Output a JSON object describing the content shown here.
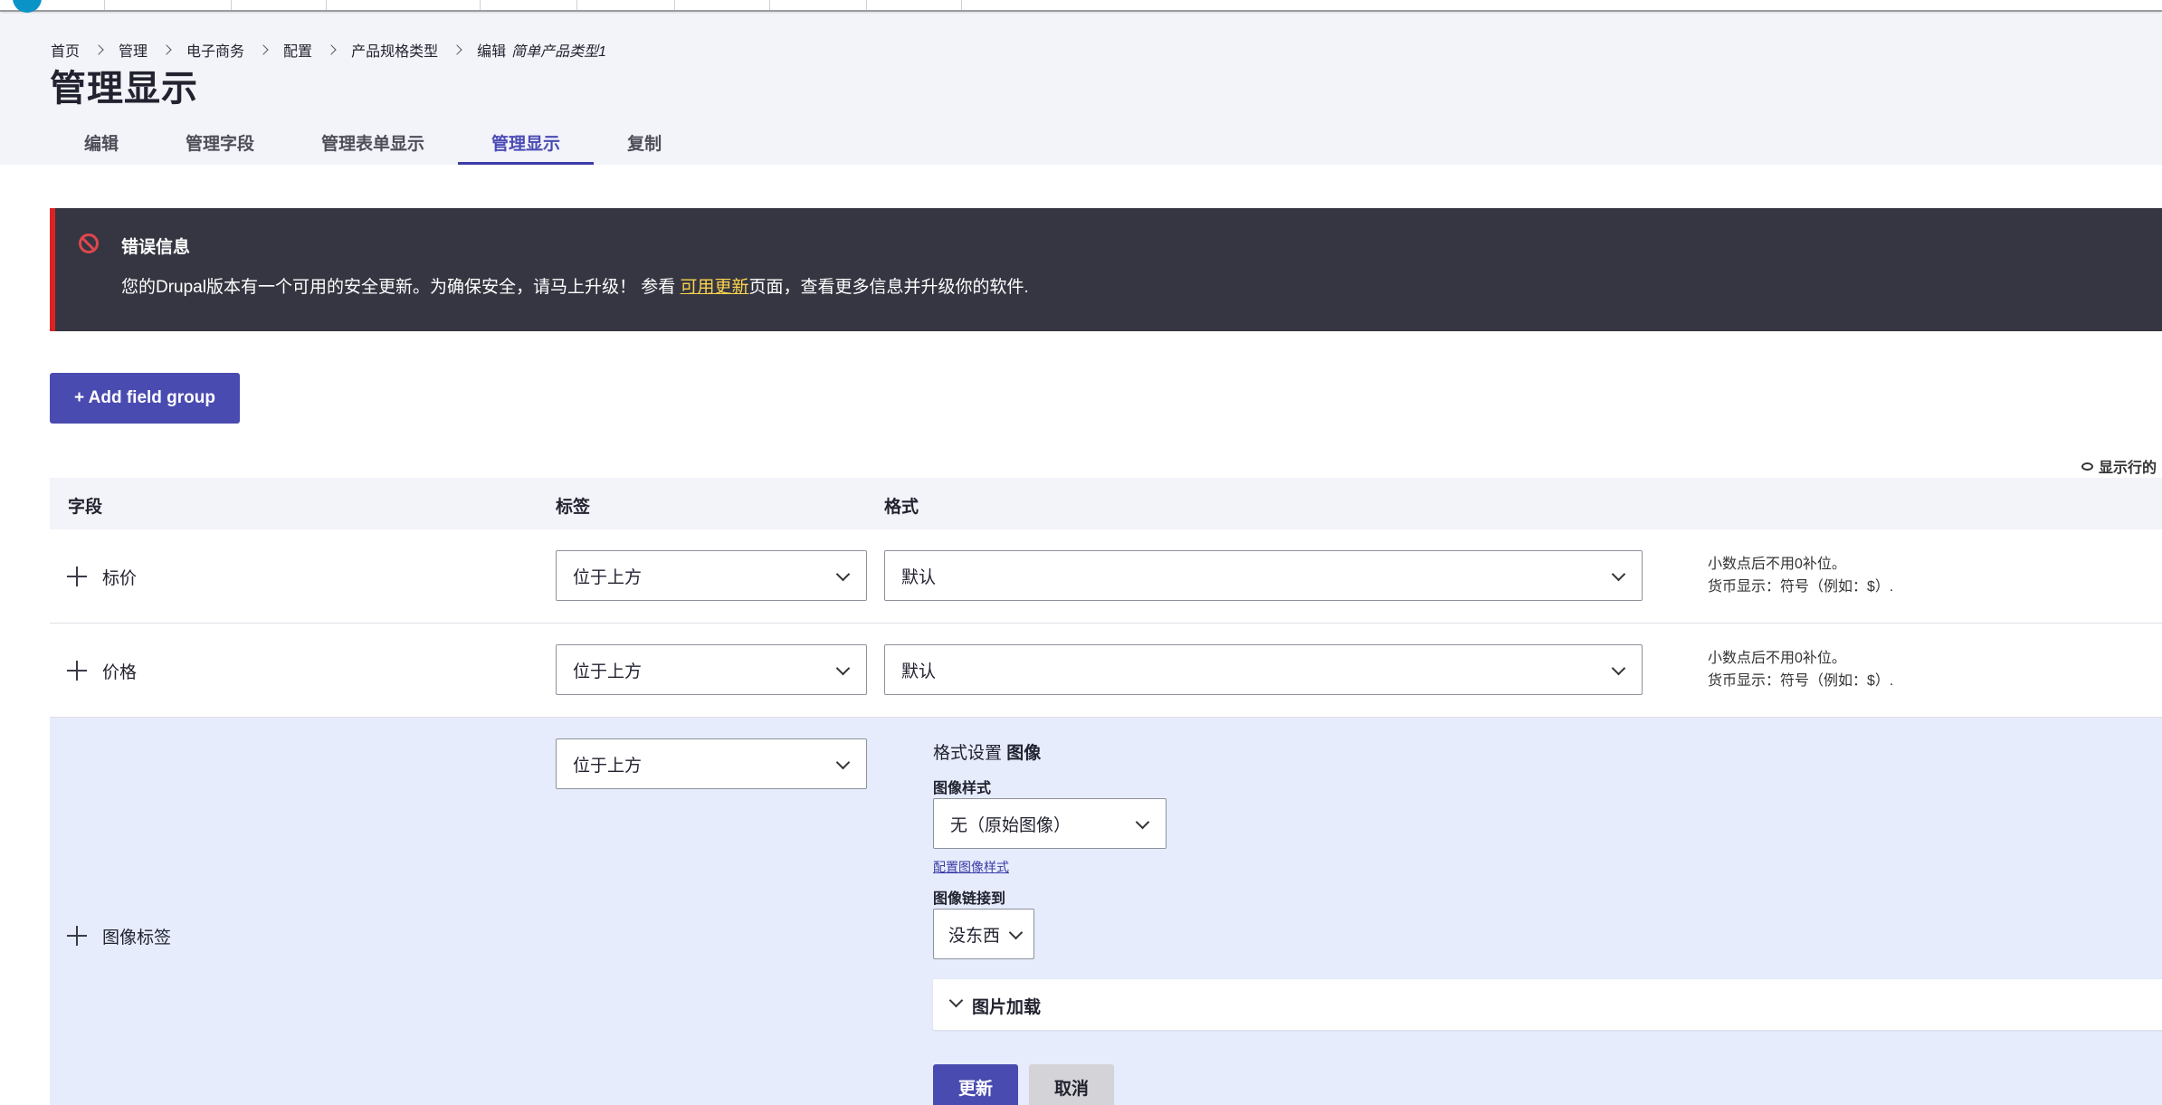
{
  "breadcrumb": {
    "items": [
      "首页",
      "管理",
      "电子商务",
      "配置",
      "产品规格类型"
    ],
    "last_prefix": "编辑",
    "last_italic": "简单产品类型1"
  },
  "page_title": "管理显示",
  "tabs": [
    "编辑",
    "管理字段",
    "管理表单显示",
    "管理显示",
    "复制"
  ],
  "active_tab": "管理显示",
  "error": {
    "title": "错误信息",
    "text_before": "您的Drupal版本有一个可用的安全更新。为确保安全，请马上升级！ 参看 ",
    "link": "可用更新",
    "text_after": "页面，查看更多信息并升级你的软件."
  },
  "add_field_group": "+ Add field group",
  "show_weights": "显示行的",
  "table": {
    "headers": [
      "字段",
      "标签",
      "格式"
    ],
    "rows": [
      {
        "field": "标价",
        "label_option": "位于上方",
        "format_option": "默认",
        "summary": [
          "小数点后不用0补位。",
          "货币显示：符号（例如：$）."
        ]
      },
      {
        "field": "价格",
        "label_option": "位于上方",
        "format_option": "默认",
        "summary": [
          "小数点后不用0补位。",
          "货币显示：符号（例如：$）."
        ]
      }
    ],
    "expanded_row": {
      "field": "图像标签",
      "label_option": "位于上方",
      "settings_prefix": "格式设置",
      "settings_name": "图像",
      "image_style_label": "图像样式",
      "image_style_value": "无（原始图像）",
      "configure_link": "配置图像样式",
      "link_to_label": "图像链接到",
      "link_to_value": "没东西",
      "loading_label": "图片加载",
      "update_button": "更新",
      "cancel_button": "取消"
    }
  }
}
